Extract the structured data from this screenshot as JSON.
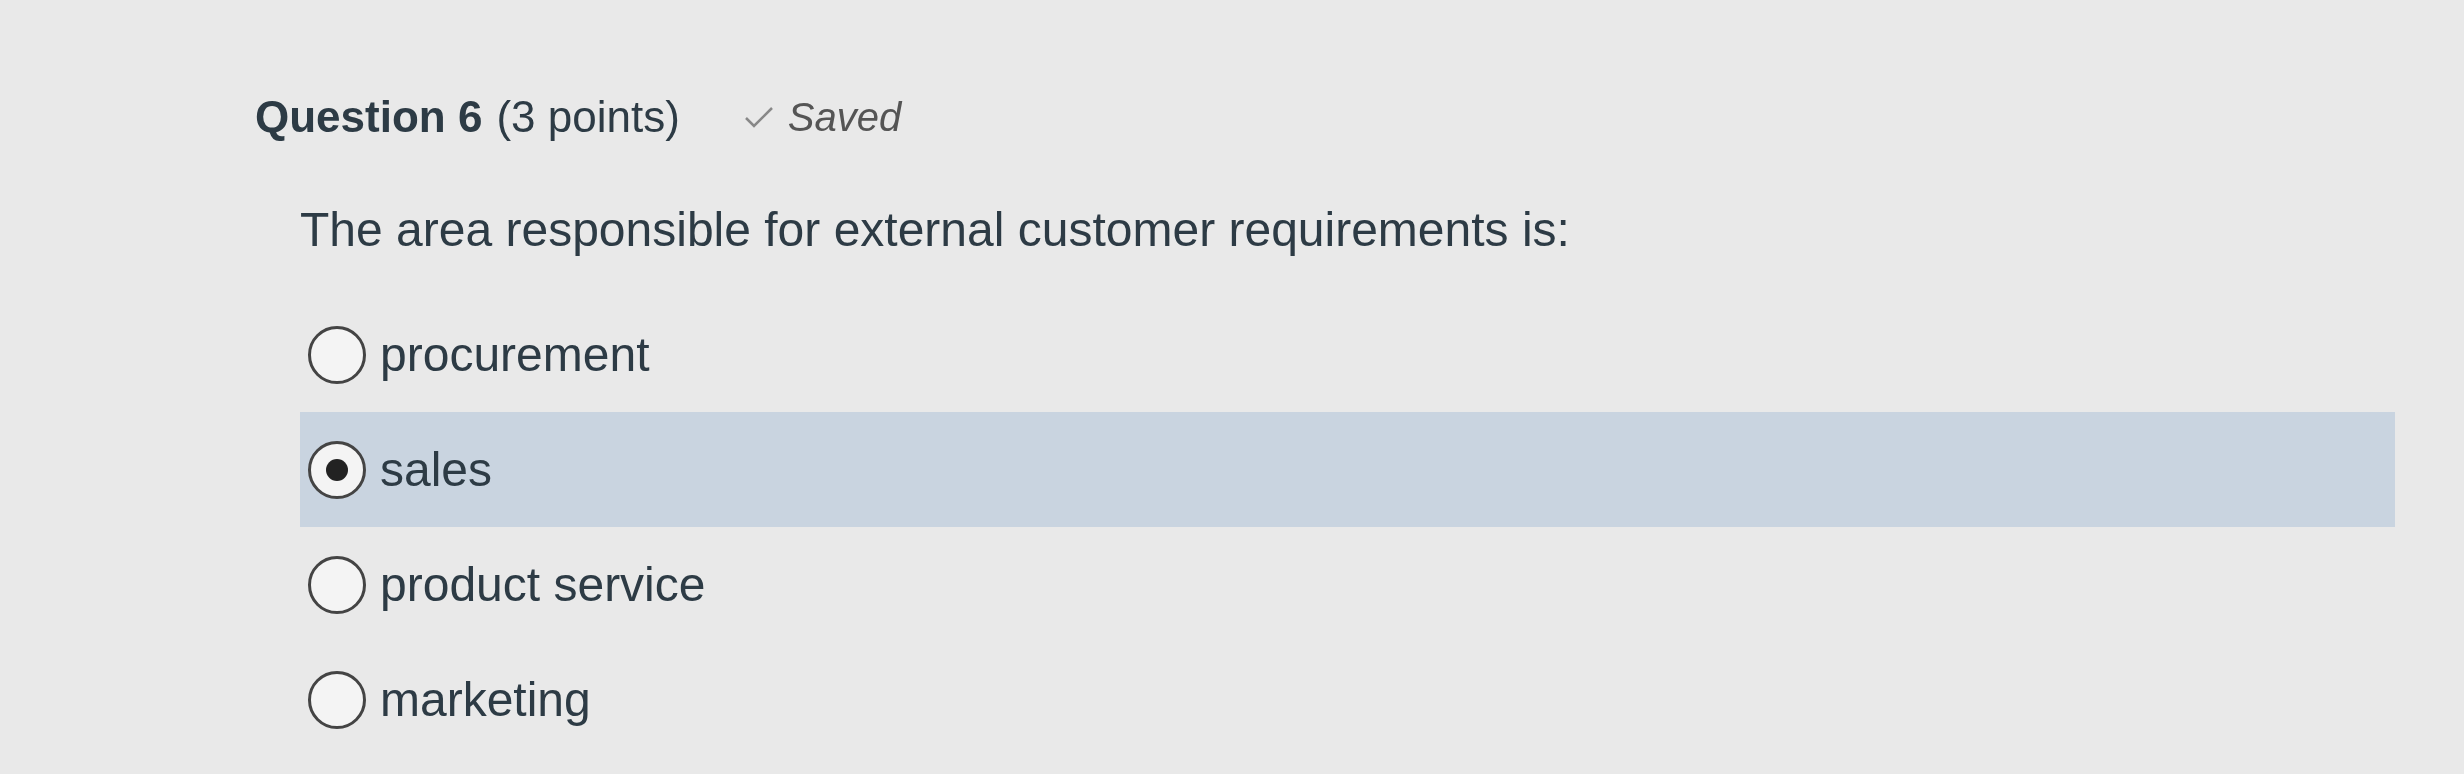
{
  "question": {
    "title": "Question 6",
    "points": "(3 points)",
    "saved_label": "Saved",
    "text": "The area responsible for external customer requirements is:"
  },
  "options": [
    {
      "label": "procurement",
      "selected": false
    },
    {
      "label": "sales",
      "selected": true
    },
    {
      "label": "product service",
      "selected": false
    },
    {
      "label": "marketing",
      "selected": false
    }
  ]
}
